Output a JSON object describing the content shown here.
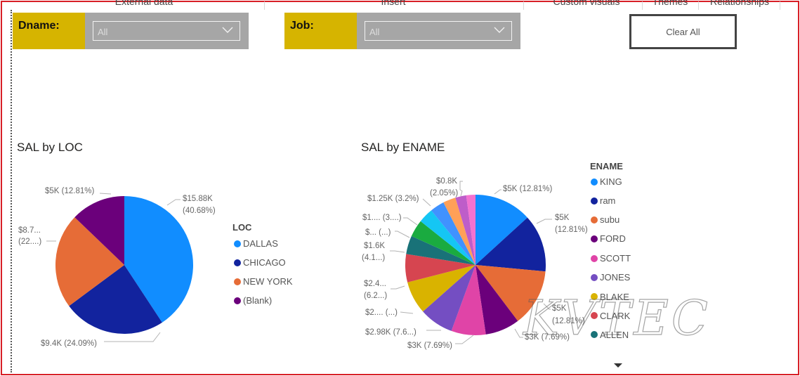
{
  "ribbon": {
    "tabs": [
      "External data",
      "Insert",
      "Custom visuals",
      "Themes",
      "Relationships"
    ]
  },
  "slicers": {
    "dname": {
      "label": "Dname:",
      "value": "All"
    },
    "job": {
      "label": "Job:",
      "value": "All"
    }
  },
  "clear_all_label": "Clear All",
  "chart_loc": {
    "title": "SAL by LOC",
    "legend_title": "LOC",
    "legend": [
      {
        "name": "DALLAS",
        "color": "#118DFF"
      },
      {
        "name": "CHICAGO",
        "color": "#12239E"
      },
      {
        "name": "NEW YORK",
        "color": "#E66C37"
      },
      {
        "name": "(Blank)",
        "color": "#6B007B"
      }
    ],
    "labels": {
      "dallas_a": "$15.88K",
      "dallas_b": "(40.68%)",
      "chicago": "$9.4K (24.09%)",
      "newyork_a": "$8.7...",
      "newyork_b": "(22....)",
      "blank": "$5K (12.81%)"
    }
  },
  "chart_ename": {
    "title": "SAL by ENAME",
    "legend_title": "ENAME",
    "legend": [
      {
        "name": "KING",
        "color": "#118DFF"
      },
      {
        "name": "ram",
        "color": "#12239E"
      },
      {
        "name": "subu",
        "color": "#E66C37"
      },
      {
        "name": "FORD",
        "color": "#6B007B"
      },
      {
        "name": "SCOTT",
        "color": "#E044A7"
      },
      {
        "name": "JONES",
        "color": "#744EC2"
      },
      {
        "name": "BLAKE",
        "color": "#D9B300"
      },
      {
        "name": "CLARK",
        "color": "#D64550"
      },
      {
        "name": "ALLEN",
        "color": "#197278"
      }
    ],
    "labels": {
      "king": "$5K (12.81%)",
      "ram_a": "$5K",
      "ram_b": "(12.81%)",
      "subu_a": "$5K",
      "subu_b": "(12.81%)",
      "ford": "$3K (7.69%)",
      "scott": "$3K (7.69%)",
      "jones": "$2.98K (7.6...)",
      "blake": "$2.... (...)",
      "clark_a": "$2.4...",
      "clark_b": "(6.2...)",
      "allen_a": "$1.6K",
      "allen_b": "(4.1...)",
      "s10": "$... (...)",
      "s11": "$1.... (3....)",
      "s12": "$1.25K (3.2%)",
      "s15_a": "$0.8K",
      "s15_b": "(2.05%)"
    }
  },
  "chart_data": [
    {
      "type": "pie",
      "title": "SAL by LOC",
      "categories": [
        "DALLAS",
        "CHICAGO",
        "NEW YORK",
        "(Blank)"
      ],
      "values": [
        15.88,
        9.4,
        8.7,
        5
      ],
      "percent": [
        40.68,
        24.09,
        22.42,
        12.81
      ],
      "legend_title": "LOC",
      "legend_position": "right"
    },
    {
      "type": "pie",
      "title": "SAL by ENAME",
      "categories": [
        "KING",
        "ram",
        "subu",
        "FORD",
        "SCOTT",
        "JONES",
        "BLAKE",
        "CLARK",
        "ALLEN"
      ],
      "values": [
        5,
        5,
        5,
        3,
        3,
        2.98,
        2.85,
        2.45,
        1.6,
        1.5,
        1.3,
        1.25,
        1.1,
        0.95,
        0.8
      ],
      "percent": [
        12.81,
        12.81,
        12.81,
        7.69,
        7.69,
        7.64,
        7.3,
        6.28,
        4.1,
        3.84,
        3.33,
        3.2,
        2.82,
        2.43,
        2.05
      ],
      "slice_colors": [
        "#118DFF",
        "#12239E",
        "#E66C37",
        "#6B007B",
        "#E044A7",
        "#744EC2",
        "#D9B300",
        "#D64550",
        "#197278",
        "#1AAB40",
        "#15C6F4",
        "#4092FF",
        "#FFA058",
        "#BE5DC9",
        "#F472D0",
        "#B5A1FF"
      ],
      "legend_title": "ENAME",
      "legend_position": "right"
    }
  ]
}
